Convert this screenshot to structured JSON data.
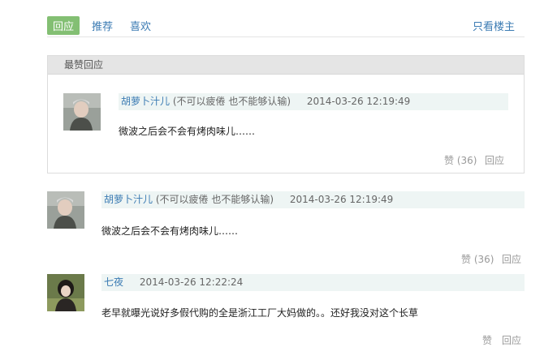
{
  "tabs": {
    "reply": "回应",
    "recommend": "推荐",
    "like": "喜欢",
    "only_op": "只看楼主"
  },
  "best_section": {
    "title": "最赞回应",
    "comment": {
      "author": "胡萝卜汁儿",
      "signature": "(不可以疲倦 也不能够认输)",
      "time": "2014-03-26 12:19:49",
      "text": "微波之后会不会有烤肉味儿……",
      "like_label": "赞 (36)",
      "reply_label": "回应"
    }
  },
  "comments": [
    {
      "author": "胡萝卜汁儿",
      "signature": "(不可以疲倦 也不能够认输)",
      "time": "2014-03-26 12:19:49",
      "text": "微波之后会不会有烤肉味儿……",
      "like_label": "赞 (36)",
      "reply_label": "回应"
    },
    {
      "author": "七夜",
      "signature": "",
      "time": "2014-03-26 12:22:24",
      "text": "老早就曝光说好多假代购的全是浙江工厂大妈做的。。还好我没对这个长草",
      "like_label": "赞",
      "reply_label": "回应"
    }
  ],
  "colors": {
    "accent": "#83bf73",
    "link": "#3b7bb3",
    "meta_bg": "#eef5f4"
  }
}
